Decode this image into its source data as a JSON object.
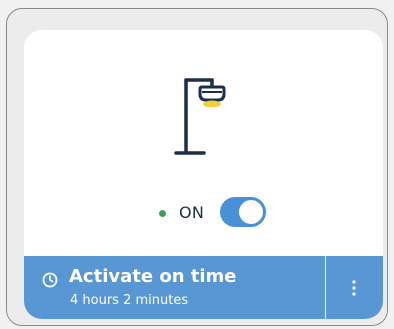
{
  "device": {
    "icon": "street-lamp-icon",
    "status": {
      "label": "ON",
      "indicator_color": "#3da05a",
      "toggle_on": true
    }
  },
  "schedule": {
    "icon": "clock-icon",
    "title": "Activate on time",
    "subtitle": "4 hours 2 minutes",
    "menu_icon": "more-vertical-icon"
  },
  "colors": {
    "accent": "#4a90d9",
    "bar": "#5897d4",
    "text_dark": "#1b2f4a",
    "lamp_glow": "#f2d23c"
  }
}
